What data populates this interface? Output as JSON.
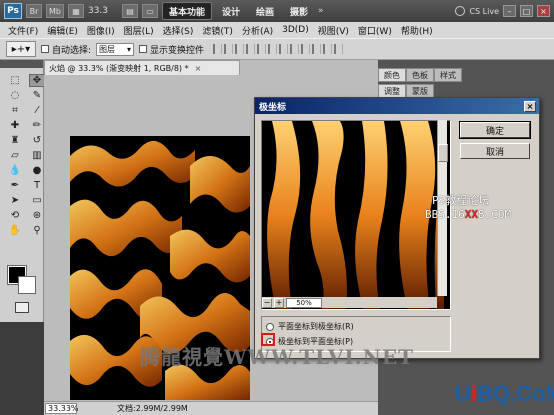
{
  "appbar": {
    "logo": "Ps",
    "br_label": "Br",
    "mb_label": "Mb",
    "zoom": "33.3",
    "workspaces": [
      "基本功能",
      "设计",
      "绘画",
      "摄影"
    ],
    "more": "»",
    "cs_live": "CS Live"
  },
  "menu": [
    "文件(F)",
    "编辑(E)",
    "图像(I)",
    "图层(L)",
    "选择(S)",
    "滤镜(T)",
    "分析(A)",
    "3D(D)",
    "视图(V)",
    "窗口(W)",
    "帮助(H)"
  ],
  "options": {
    "auto_select": "自动选择:",
    "layer_select": "图层",
    "show_transform": "显示变换控件"
  },
  "document": {
    "tab_title": "火焰 @ 33.3% (渐变映射 1, RGB/8) *",
    "close": "×",
    "status_zoom": "33.33%",
    "status_doc": "文档:2.99M/2.99M"
  },
  "panels": {
    "tabs_top": [
      "颜色",
      "色板",
      "样式"
    ],
    "tabs_bottom": [
      "调整",
      "蒙版"
    ]
  },
  "dialog": {
    "title": "极坐标",
    "ok": "确定",
    "cancel": "取消",
    "zoom_pct": "50%",
    "minus": "−",
    "plus": "+",
    "options": [
      "平面坐标到极坐标(R)",
      "极坐标到平面坐标(P)"
    ],
    "selected_option": 1
  },
  "watermarks": {
    "ps_forum": "PS教程论坛",
    "bbs_pre": "BBS.16",
    "bbs_red": "XX",
    "bbs_post": "8.COM",
    "tlvi": "腾龍視覺WWW.TLVI.NET",
    "uibq_pre": "U",
    "uibq_hl": "i",
    "uibq_post": "BQ.CoM"
  },
  "colors": {
    "fire_dark": "#000000",
    "fire_orange": "#e07b18",
    "fire_yellow": "#ffd060",
    "dialog_bg": "#d4d0c8"
  }
}
